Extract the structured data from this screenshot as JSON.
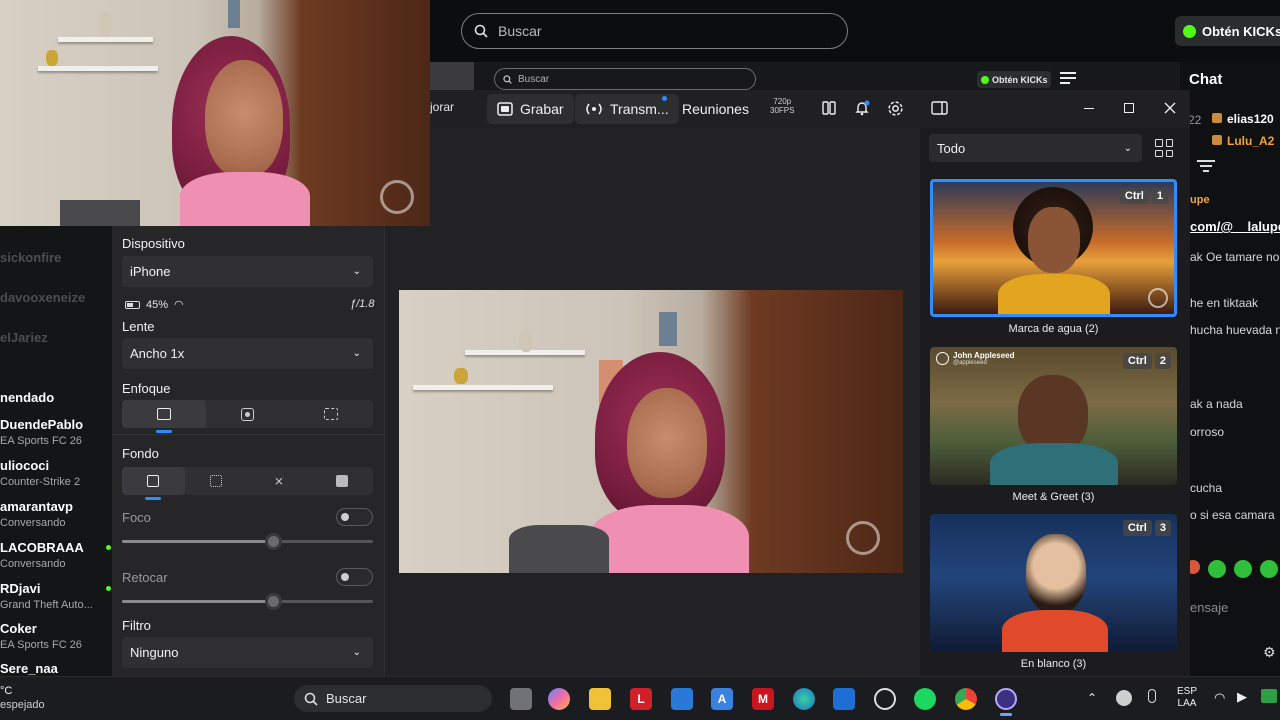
{
  "kick": {
    "search_placeholder": "Buscar",
    "cta_label": "Obtén KICKs",
    "inner_search_placeholder": "Buscar",
    "inner_cta_label": "Obtén KICKs",
    "chat_title": "Chat",
    "chat_lines": [
      {
        "user": "elias120",
        "color": "#ffffff"
      },
      {
        "user": "Lulu_A2",
        "color": "#f2a43a"
      },
      {
        "text": "upe"
      },
      {
        "text": "com/@__lalupe"
      },
      {
        "text": "ak Oe tamare no"
      },
      {
        "text": "he en tiktaak"
      },
      {
        "text": "hucha huevada n"
      },
      {
        "text": "ak a nada"
      },
      {
        "text": "orroso"
      },
      {
        "text": "cucha"
      },
      {
        "text": "o si esa camara"
      },
      {
        "text": "ensaje"
      }
    ],
    "chat_num": "22",
    "sidebar_faded": [
      "sickonfire",
      "davooxeneize",
      "elJariez"
    ],
    "sidebar_header": "nendado",
    "sidebar_channels": [
      {
        "name": "DuendePablo",
        "game": "EA Sports FC 26",
        "live": false
      },
      {
        "name": "uliococi",
        "game": "Counter-Strike 2",
        "live": false
      },
      {
        "name": "amarantavp",
        "game": "Conversando",
        "live": false
      },
      {
        "name": "LACOBRAAA",
        "game": "Conversando",
        "live": true
      },
      {
        "name": "RDjavi",
        "game": "Grand Theft Auto...",
        "live": true
      },
      {
        "name": "Coker",
        "game": "EA Sports FC 26",
        "live": false
      },
      {
        "name": "Sere_naa",
        "game": "",
        "live": false
      }
    ]
  },
  "toolbar": {
    "improve_label": "jorar",
    "record_label": "Grabar",
    "stream_label": "Transm...",
    "meetings_label": "Reuniones",
    "res_line1": "720p",
    "res_line2": "30FPS"
  },
  "settings": {
    "device_label": "Dispositivo",
    "device_value": "iPhone",
    "battery": "45%",
    "aperture": "ƒ/1.8",
    "lens_label": "Lente",
    "lens_value": "Ancho 1x",
    "focus_label": "Enfoque",
    "background_label": "Fondo",
    "blur_label": "Foco",
    "blur_level": 0.6,
    "retouch_label": "Retocar",
    "retouch_level": 0.6,
    "filter_label": "Filtro",
    "filter_value": "Ninguno"
  },
  "scenes": {
    "filter_value": "Todo",
    "items": [
      {
        "label": "Marca de agua (2)",
        "ctrl": "Ctrl",
        "num": "1",
        "active": true
      },
      {
        "label": "Meet & Greet (3)",
        "ctrl": "Ctrl",
        "num": "2",
        "active": false,
        "overlay_name": "John Appleseed",
        "overlay_handle": "@appleseed"
      },
      {
        "label": "En blanco (3)",
        "ctrl": "Ctrl",
        "num": "3",
        "active": false
      }
    ]
  },
  "taskbar": {
    "weather_temp": "°C",
    "weather_desc": "espejado",
    "search_label": "Buscar",
    "lang": "ESP",
    "lang2": "LAA"
  }
}
